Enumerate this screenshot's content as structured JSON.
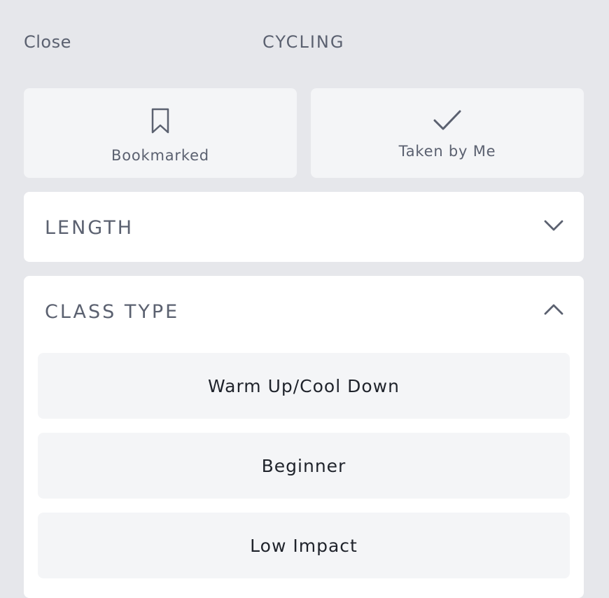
{
  "header": {
    "close_label": "Close",
    "title": "CYCLING"
  },
  "quick_filters": {
    "bookmarked": {
      "label": "Bookmarked",
      "icon": "bookmark-icon"
    },
    "taken": {
      "label": "Taken by Me",
      "icon": "checkmark-icon"
    }
  },
  "sections": {
    "length": {
      "title": "LENGTH",
      "expanded": false,
      "icon": "chevron-down-icon"
    },
    "class_type": {
      "title": "CLASS TYPE",
      "expanded": true,
      "icon": "chevron-up-icon",
      "options": [
        "Warm Up/Cool Down",
        "Beginner",
        "Low Impact"
      ]
    }
  },
  "colors": {
    "background": "#e6e7eb",
    "card": "#f4f5f7",
    "panel": "#ffffff",
    "text_muted": "#5b6170",
    "text_dark": "#1f232b"
  }
}
